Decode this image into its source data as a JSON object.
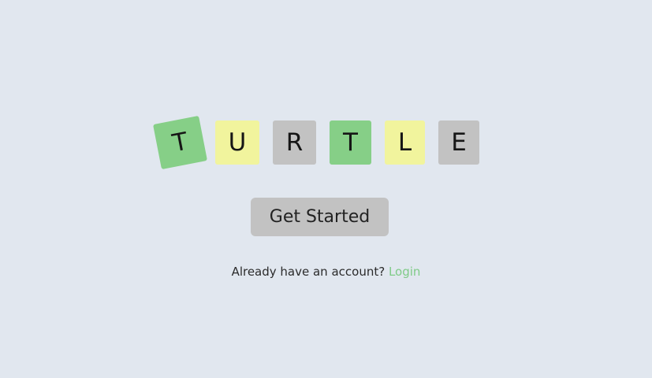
{
  "logo": {
    "tiles": [
      {
        "letter": "T",
        "color": "green"
      },
      {
        "letter": "U",
        "color": "yellow"
      },
      {
        "letter": "R",
        "color": "gray"
      },
      {
        "letter": "T",
        "color": "green"
      },
      {
        "letter": "L",
        "color": "yellow"
      },
      {
        "letter": "E",
        "color": "gray"
      }
    ]
  },
  "colors": {
    "background": "#e1e7ef",
    "green": "#86cf87",
    "yellow": "#f1f49d",
    "gray": "#c2c2c2",
    "link": "#7fcb87"
  },
  "actions": {
    "get_started_label": "Get Started"
  },
  "login_prompt": {
    "text": "Already have an account?",
    "link_label": "Login"
  }
}
